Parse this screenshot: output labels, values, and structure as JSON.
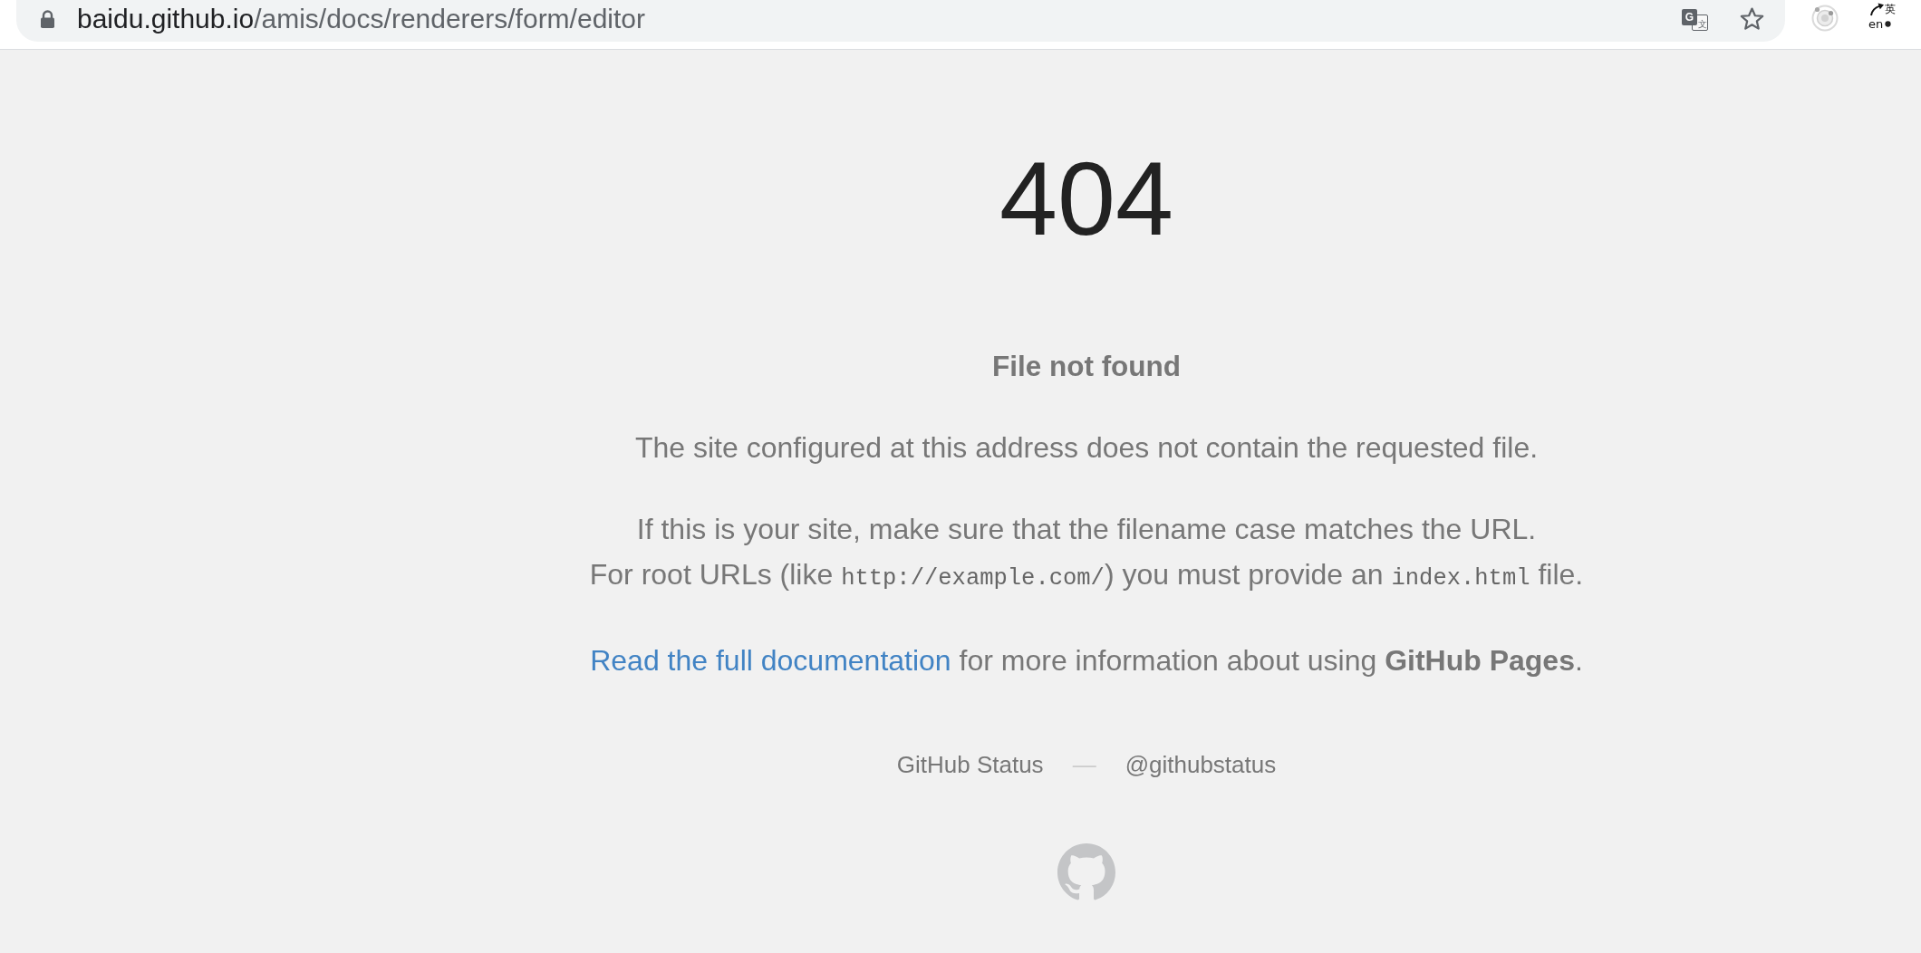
{
  "browser": {
    "address": {
      "host": "baidu.github.io",
      "path": "/amis/docs/renderers/form/editor"
    },
    "translate_button": {
      "glyphs": [
        "G",
        "文"
      ]
    },
    "bookmarked": false,
    "extensions": [
      {
        "kind": "rings"
      },
      {
        "kind": "language",
        "labels": [
          "英",
          "en"
        ]
      }
    ]
  },
  "error": {
    "code": "404",
    "title": "File not found",
    "paragraphs": [
      {
        "lines": [
          [
            {
              "kind": "text",
              "text": "The site configured at this address does not contain the requested file."
            }
          ]
        ]
      },
      {
        "lines": [
          [
            {
              "kind": "text",
              "text": "If this is your site, make sure that the filename case matches the URL."
            }
          ],
          [
            {
              "kind": "text",
              "text": "For root URLs (like "
            },
            {
              "kind": "code",
              "text": "http://example.com/"
            },
            {
              "kind": "text",
              "text": ") you must provide an "
            },
            {
              "kind": "code",
              "text": "index.html"
            },
            {
              "kind": "text",
              "text": " file."
            }
          ]
        ]
      },
      {
        "lines": [
          [
            {
              "kind": "link",
              "text": "Read the full documentation"
            },
            {
              "kind": "text",
              "text": " for more information about using **GitHub Pages**."
            }
          ]
        ]
      }
    ]
  },
  "footer": {
    "items": [
      {
        "kind": "link",
        "text": "GitHub Status"
      },
      {
        "kind": "separator",
        "text": "—"
      },
      {
        "kind": "link",
        "text": "@githubstatus"
      }
    ]
  }
}
